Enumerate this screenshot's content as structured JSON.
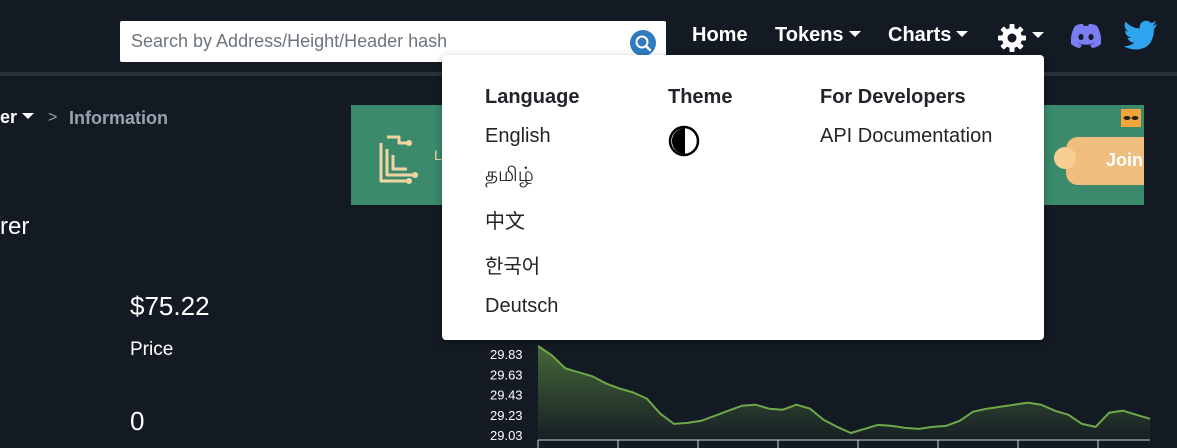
{
  "header": {
    "search": {
      "placeholder": "Search by Address/Height/Header hash",
      "icon": "search-icon"
    },
    "nav": {
      "home": "Home",
      "tokens": "Tokens",
      "charts": "Charts",
      "settings_icon": "gear-icon",
      "discord_icon": "discord-icon",
      "twitter_icon": "twitter-icon"
    }
  },
  "breadcrumb": {
    "parent": "er",
    "separator": ">",
    "current": "Information"
  },
  "section": {
    "title": "rer"
  },
  "stats": {
    "price_value": "$75.22",
    "price_label": "Price",
    "second_value": "0"
  },
  "banner": {
    "letter": "L",
    "join_label": "Join",
    "background": "#3b8a6c",
    "button_color": "#efbd7e"
  },
  "settings_menu": {
    "language": {
      "heading": "Language",
      "options": [
        "English",
        "தமிழ்",
        "中文",
        "한국어",
        "Deutsch"
      ]
    },
    "theme": {
      "heading": "Theme",
      "toggle_icon": "half-moon-icon"
    },
    "developers": {
      "heading": "For Developers",
      "links": [
        "API Documentation"
      ]
    }
  },
  "chart_data": {
    "type": "area",
    "y_ticks": [
      "29.83",
      "29.63",
      "29.43",
      "29.23",
      "29.03"
    ],
    "ylim": [
      29.03,
      29.92
    ],
    "x": [
      0,
      1,
      2,
      3,
      4,
      5,
      6,
      7,
      8,
      9,
      10,
      11,
      12,
      13,
      14,
      15,
      16,
      17,
      18,
      19,
      20,
      21,
      22,
      23,
      24,
      25,
      26,
      27,
      28,
      29,
      30,
      31,
      32,
      33,
      34,
      35,
      36,
      37,
      38,
      39,
      40,
      41,
      42,
      43,
      44,
      45
    ],
    "values": [
      29.92,
      29.83,
      29.7,
      29.66,
      29.62,
      29.55,
      29.5,
      29.46,
      29.4,
      29.25,
      29.15,
      29.16,
      29.18,
      29.23,
      29.28,
      29.33,
      29.34,
      29.3,
      29.29,
      29.34,
      29.3,
      29.19,
      29.12,
      29.06,
      29.1,
      29.14,
      29.13,
      29.11,
      29.1,
      29.12,
      29.13,
      29.18,
      29.27,
      29.3,
      29.32,
      29.34,
      29.36,
      29.34,
      29.28,
      29.24,
      29.15,
      29.12,
      29.26,
      29.28,
      29.24,
      29.2
    ],
    "line_color": "#6ea84a"
  }
}
